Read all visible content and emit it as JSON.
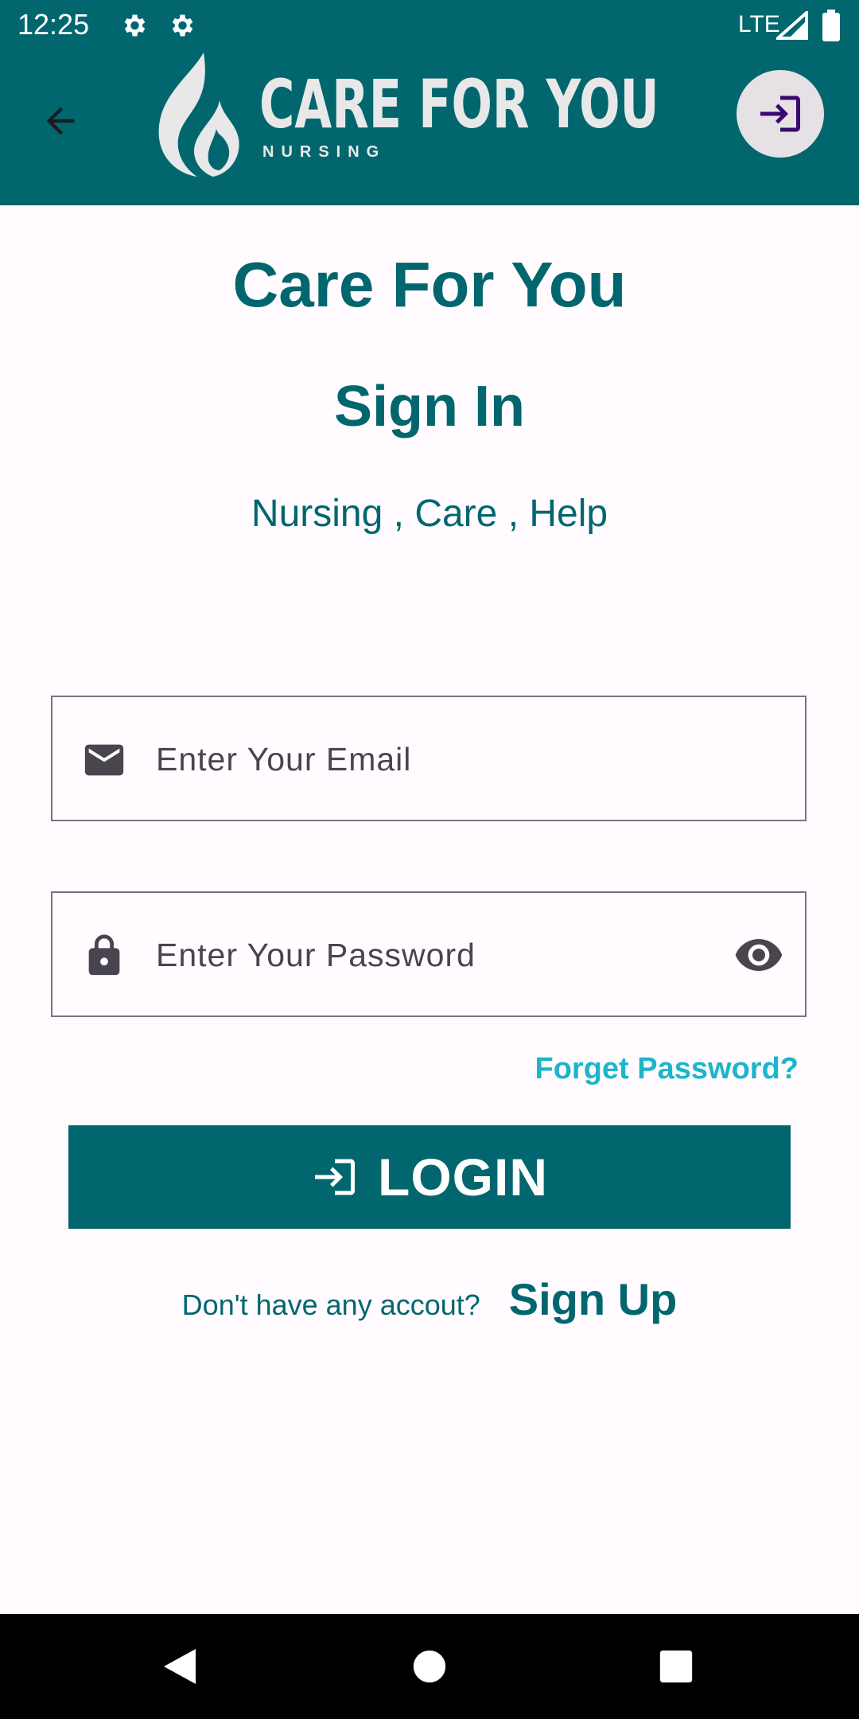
{
  "status": {
    "time": "12:25",
    "network": "LTE"
  },
  "appbar": {
    "logo_title": "CARE FOR YOU",
    "logo_subtitle": "NURSING",
    "colors": {
      "bar": "#02666f",
      "action_circle": "#e5e1e5"
    },
    "icons": [
      "back-arrow-icon",
      "login-icon"
    ]
  },
  "main": {
    "app_title": "Care For You",
    "page_title": "Sign In",
    "tagline": "Nursing , Care , Help"
  },
  "form": {
    "email": {
      "placeholder": "Enter Your Email",
      "value": ""
    },
    "password": {
      "placeholder": "Enter Your Password",
      "value": ""
    },
    "forgot_label": "Forget Password?",
    "login_label": "LOGIN"
  },
  "signup": {
    "question": "Don't have any accout?",
    "link_label": "Sign Up"
  },
  "colors": {
    "primary": "#02666f",
    "link_accent": "#1cb5c9"
  }
}
